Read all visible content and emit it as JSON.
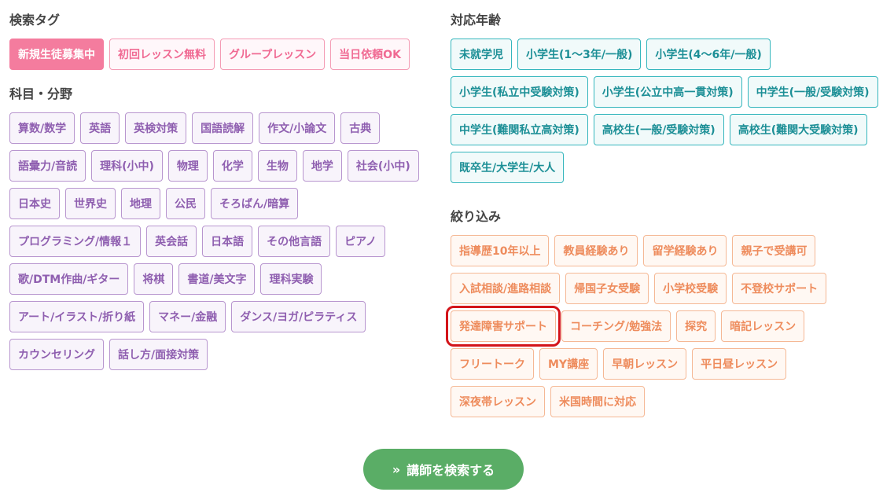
{
  "search_tags": {
    "title": "検索タグ",
    "items": [
      {
        "label": "新規生徒募集中",
        "active": true
      },
      {
        "label": "初回レッスン無料",
        "active": false
      },
      {
        "label": "グループレッスン",
        "active": false
      },
      {
        "label": "当日依頼OK",
        "active": false
      }
    ]
  },
  "subjects": {
    "title": "科目・分野",
    "items": [
      "算数/数学",
      "英語",
      "英検対策",
      "国語読解",
      "作文/小論文",
      "古典",
      "語彙力/音読",
      "理科(小中)",
      "物理",
      "化学",
      "生物",
      "地学",
      "社会(小中)",
      "日本史",
      "世界史",
      "地理",
      "公民",
      "そろばん/暗算",
      "プログラミング/情報１",
      "英会話",
      "日本語",
      "その他言語",
      "ピアノ",
      "歌/DTM作曲/ギター",
      "将棋",
      "書道/美文字",
      "理科実験",
      "アート/イラスト/折り紙",
      "マネー/金融",
      "ダンス/ヨガ/ピラティス",
      "カウンセリング",
      "話し方/面接対策"
    ]
  },
  "ages": {
    "title": "対応年齢",
    "items": [
      "未就学児",
      "小学生(1〜3年/一般)",
      "小学生(4〜6年/一般)",
      "小学生(私立中受験対策)",
      "小学生(公立中高一貫対策)",
      "中学生(一般/受験対策)",
      "中学生(難関私立高対策)",
      "高校生(一般/受験対策)",
      "高校生(難関大受験対策)",
      "既卒生/大学生/大人"
    ]
  },
  "filters": {
    "title": "絞り込み",
    "items": [
      "指導歴10年以上",
      "教員経験あり",
      "留学経験あり",
      "親子で受講可",
      "入試相談/進路相談",
      "帰国子女受験",
      "小学校受験",
      "不登校サポート",
      "発達障害サポート",
      "コーチング/勉強法",
      "探究",
      "暗記レッスン",
      "フリートーク",
      "MY講座",
      "早朝レッスン",
      "平日昼レッスン",
      "深夜帯レッスン",
      "米国時間に対応"
    ],
    "highlighted": "発達障害サポート"
  },
  "search_button": {
    "chevron": "»",
    "label": "講師を検索する"
  },
  "colors": {
    "pink": "#f47c9e",
    "purple": "#8f5fb0",
    "teal": "#1c8f96",
    "orange": "#ee8c5d",
    "button_green": "#5aad66",
    "highlight_red": "#d3141a"
  }
}
